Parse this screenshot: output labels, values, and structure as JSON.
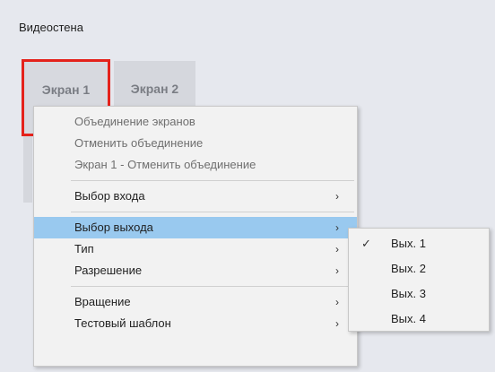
{
  "window": {
    "title": "Видеостена"
  },
  "screens": [
    {
      "label": "Экран 1",
      "selected": true
    },
    {
      "label": "Экран 2",
      "selected": false
    }
  ],
  "context_menu": {
    "group1": [
      {
        "label": "Объединение экранов",
        "disabled": true
      },
      {
        "label": "Отменить объединение",
        "disabled": true
      },
      {
        "label": "Экран 1 - Отменить объединение",
        "disabled": true
      }
    ],
    "group2": [
      {
        "label": "Выбор входа",
        "submenu": true
      }
    ],
    "group3": [
      {
        "label": "Выбор выхода",
        "submenu": true,
        "highlighted": true
      },
      {
        "label": "Тип",
        "submenu": true
      },
      {
        "label": "Разрешение",
        "submenu": true
      }
    ],
    "group4": [
      {
        "label": "Вращение",
        "submenu": true
      },
      {
        "label": "Тестовый шаблон",
        "submenu": true
      }
    ],
    "arrow_icon": "chevron-right-icon"
  },
  "output_submenu": {
    "items": [
      {
        "label": "Вых. 1",
        "checked": true
      },
      {
        "label": "Вых. 2",
        "checked": false
      },
      {
        "label": "Вых. 3",
        "checked": false
      },
      {
        "label": "Вых. 4",
        "checked": false
      }
    ],
    "check_icon": "checkmark-icon"
  },
  "colors": {
    "selection_border": "#e4221b",
    "highlight": "#99c9ef",
    "background": "#e6e8ee"
  }
}
